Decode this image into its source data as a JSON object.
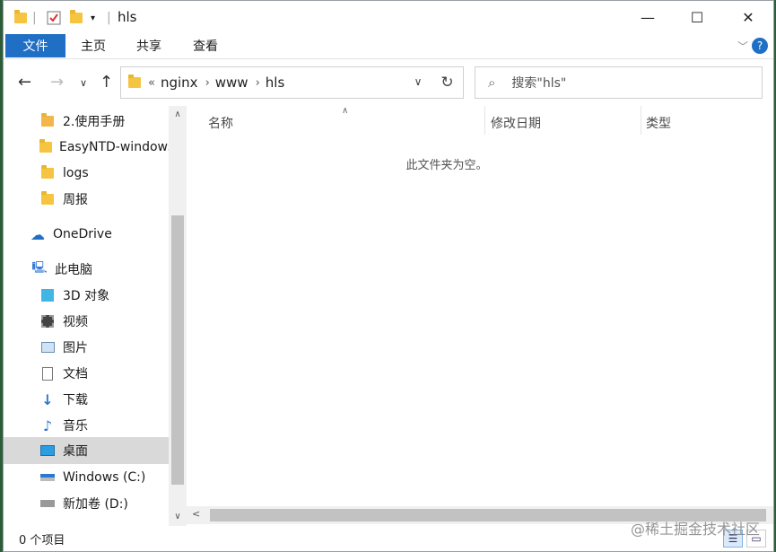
{
  "window": {
    "title": "hls",
    "controls": {
      "minimize": "—",
      "maximize": "☐",
      "close": "✕"
    }
  },
  "ribbon": {
    "tabs": [
      "文件",
      "主页",
      "共享",
      "查看"
    ],
    "help": "?"
  },
  "nav": {
    "breadcrumb_prefix": "«",
    "breadcrumb": [
      "nginx",
      "www",
      "hls"
    ],
    "search_placeholder": "搜索\"hls\""
  },
  "sidebar": {
    "items": [
      {
        "label": "2.使用手册",
        "icon": "folder-doc-icon"
      },
      {
        "label": "EasyNTD-windows",
        "icon": "folder-icon"
      },
      {
        "label": "logs",
        "icon": "folder-icon"
      },
      {
        "label": "周报",
        "icon": "folder-icon"
      },
      {
        "label": "OneDrive",
        "icon": "onedrive-cloud-icon"
      },
      {
        "label": "此电脑",
        "icon": "this-pc-icon"
      },
      {
        "label": "3D 对象",
        "icon": "3d-objects-icon"
      },
      {
        "label": "视频",
        "icon": "videos-icon"
      },
      {
        "label": "图片",
        "icon": "pictures-icon"
      },
      {
        "label": "文档",
        "icon": "documents-icon"
      },
      {
        "label": "下载",
        "icon": "downloads-icon"
      },
      {
        "label": "音乐",
        "icon": "music-icon"
      },
      {
        "label": "桌面",
        "icon": "desktop-icon",
        "selected": true
      },
      {
        "label": "Windows (C:)",
        "icon": "drive-c-icon"
      },
      {
        "label": "新加卷 (D:)",
        "icon": "drive-d-icon"
      }
    ]
  },
  "main": {
    "columns": [
      "名称",
      "修改日期",
      "类型"
    ],
    "empty_message": "此文件夹为空。"
  },
  "status": {
    "item_count": "0 个项目"
  },
  "watermark": "@稀土掘金技术社区",
  "colors": {
    "accent": "#1f6fc5",
    "folder": "#f5c542",
    "selected_bg": "#d9d9d9"
  }
}
